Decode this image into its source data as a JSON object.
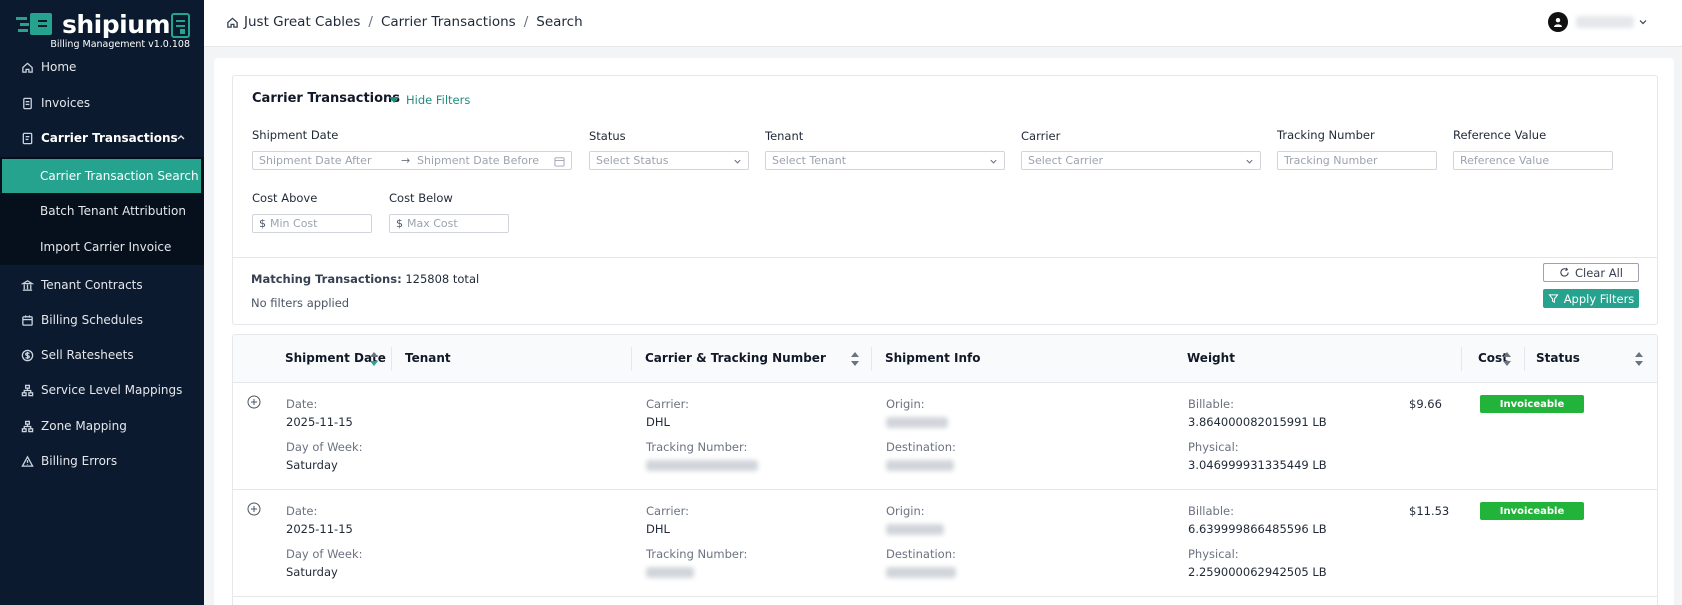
{
  "brand": {
    "name": "shipium",
    "subtitle": "Billing Management v1.0.108",
    "accent": "#25a38f"
  },
  "sidebar": {
    "items": [
      {
        "label": "Home",
        "icon": "home-icon"
      },
      {
        "label": "Invoices",
        "icon": "invoice-icon"
      },
      {
        "label": "Carrier Transactions",
        "icon": "transactions-icon",
        "expanded": true,
        "children": [
          {
            "label": "Carrier Transaction Search",
            "active": true
          },
          {
            "label": "Batch Tenant Attribution"
          },
          {
            "label": "Import Carrier Invoice"
          }
        ]
      },
      {
        "label": "Tenant Contracts",
        "icon": "bank-icon"
      },
      {
        "label": "Billing Schedules",
        "icon": "calendar-icon"
      },
      {
        "label": "Sell Ratesheets",
        "icon": "dollar-icon"
      },
      {
        "label": "Service Level Mappings",
        "icon": "hierarchy-icon"
      },
      {
        "label": "Zone Mapping",
        "icon": "hierarchy-icon"
      },
      {
        "label": "Billing Errors",
        "icon": "warning-icon"
      }
    ]
  },
  "breadcrumb": [
    "Just Great Cables",
    "Carrier Transactions",
    "Search"
  ],
  "filters": {
    "title": "Carrier Transactions",
    "toggle_label": "Hide Filters",
    "shipment_date": {
      "label": "Shipment Date",
      "after_placeholder": "Shipment Date After",
      "before_placeholder": "Shipment Date Before"
    },
    "status": {
      "label": "Status",
      "placeholder": "Select Status"
    },
    "tenant": {
      "label": "Tenant",
      "placeholder": "Select Tenant"
    },
    "carrier": {
      "label": "Carrier",
      "placeholder": "Select Carrier"
    },
    "tracking": {
      "label": "Tracking Number",
      "placeholder": "Tracking Number"
    },
    "reference": {
      "label": "Reference Value",
      "placeholder": "Reference Value"
    },
    "cost_above": {
      "label": "Cost Above",
      "currency": "$",
      "placeholder": "Min Cost"
    },
    "cost_below": {
      "label": "Cost Below",
      "currency": "$",
      "placeholder": "Max Cost"
    },
    "matching_label": "Matching Transactions:",
    "matching_value": "125808 total",
    "no_filters": "No filters applied",
    "clear_label": "Clear All",
    "apply_label": "Apply Filters"
  },
  "table": {
    "columns": [
      "Shipment Date",
      "Tenant",
      "Carrier & Tracking Number",
      "Shipment Info",
      "Weight",
      "Cost",
      "Status"
    ],
    "field_labels": {
      "date": "Date:",
      "day_of_week": "Day of Week:",
      "carrier": "Carrier:",
      "tracking_number": "Tracking Number:",
      "origin": "Origin:",
      "destination": "Destination:",
      "billable": "Billable:",
      "physical": "Physical:"
    },
    "rows": [
      {
        "date": "2025-11-15",
        "day_of_week": "Saturday",
        "carrier": "DHL",
        "billable": "3.864000082015991 LB",
        "physical": "3.046999931335449 LB",
        "cost": "$9.66",
        "status": "Invoiceable"
      },
      {
        "date": "2025-11-15",
        "day_of_week": "Saturday",
        "carrier": "DHL",
        "billable": "6.639999866485596 LB",
        "physical": "2.259000062942505 LB",
        "cost": "$11.53",
        "status": "Invoiceable"
      }
    ]
  }
}
